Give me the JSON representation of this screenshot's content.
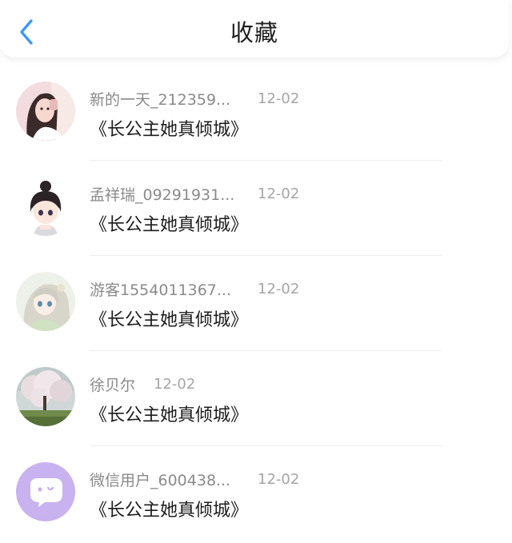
{
  "header": {
    "title": "收藏",
    "back_icon": "chevron-left-icon",
    "accent": "#3d9af5"
  },
  "items": [
    {
      "username": "新的一天_212359...",
      "date": "12-02",
      "book": "《长公主她真倾城》",
      "avatar": "girl-selfie-avatar"
    },
    {
      "username": "孟祥瑞_09291931...",
      "date": "12-02",
      "book": "《长公主她真倾城》",
      "avatar": "anime-girl-bun-avatar"
    },
    {
      "username": "游客1554011367...",
      "date": "12-02",
      "book": "《长公主她真倾城》",
      "avatar": "anime-girl-silver-hair-avatar"
    },
    {
      "username": "徐贝尔",
      "date": "12-02",
      "book": "《长公主她真倾城》",
      "avatar": "blossom-tree-avatar"
    },
    {
      "username": "微信用户_600438...",
      "date": "12-02",
      "book": "《长公主她真倾城》",
      "avatar": "wechat-default-avatar"
    }
  ]
}
